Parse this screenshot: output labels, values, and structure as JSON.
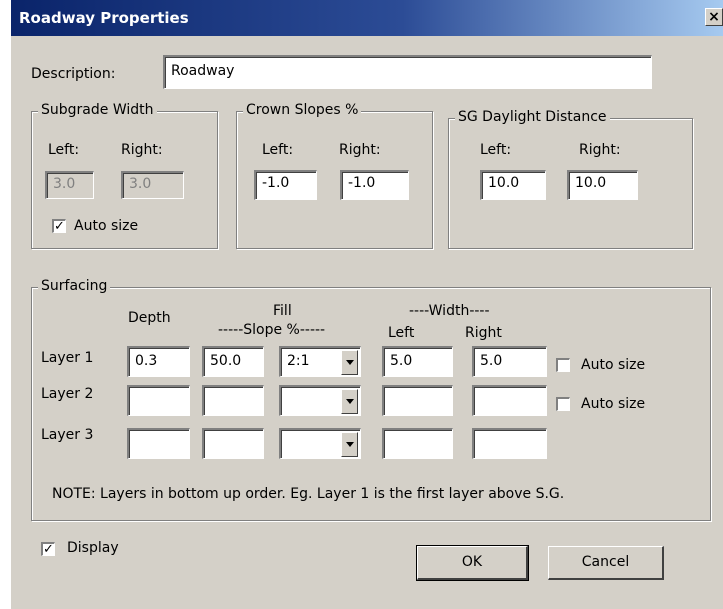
{
  "window": {
    "title": "Roadway Properties",
    "close_glyph": "×"
  },
  "description": {
    "label": "Description:",
    "value": "Roadway"
  },
  "subgrade_width": {
    "legend": "Subgrade Width",
    "left_label": "Left:",
    "right_label": "Right:",
    "left_value": "3.0",
    "right_value": "3.0",
    "auto_size_label": "Auto size",
    "auto_size_checked": true
  },
  "crown_slopes": {
    "legend": "Crown Slopes %",
    "left_label": "Left:",
    "right_label": "Right:",
    "left_value": "-1.0",
    "right_value": "-1.0"
  },
  "sg_daylight": {
    "legend": "SG Daylight Distance",
    "left_label": "Left:",
    "right_label": "Right:",
    "left_value": "10.0",
    "right_value": "10.0"
  },
  "surfacing": {
    "legend": "Surfacing",
    "headers": {
      "depth": "Depth",
      "fill": "Fill",
      "slope": "-----Slope %-----",
      "width": "----Width----",
      "left": "Left",
      "right": "Right"
    },
    "layers": [
      {
        "label": "Layer 1",
        "depth": "0.3",
        "fill_slope": "50.0",
        "ratio": "2:1",
        "left": "5.0",
        "right": "5.0",
        "auto_size_label": "Auto size",
        "auto_size_checked": false
      },
      {
        "label": "Layer 2",
        "depth": "",
        "fill_slope": "",
        "ratio": "",
        "left": "",
        "right": "",
        "auto_size_label": "Auto size",
        "auto_size_checked": false
      },
      {
        "label": "Layer 3",
        "depth": "",
        "fill_slope": "",
        "ratio": "",
        "left": "",
        "right": ""
      }
    ],
    "note": "NOTE: Layers in bottom up order. Eg. Layer 1 is the first layer above S.G."
  },
  "display": {
    "label": "Display",
    "checked": true
  },
  "buttons": {
    "ok": "OK",
    "cancel": "Cancel"
  }
}
